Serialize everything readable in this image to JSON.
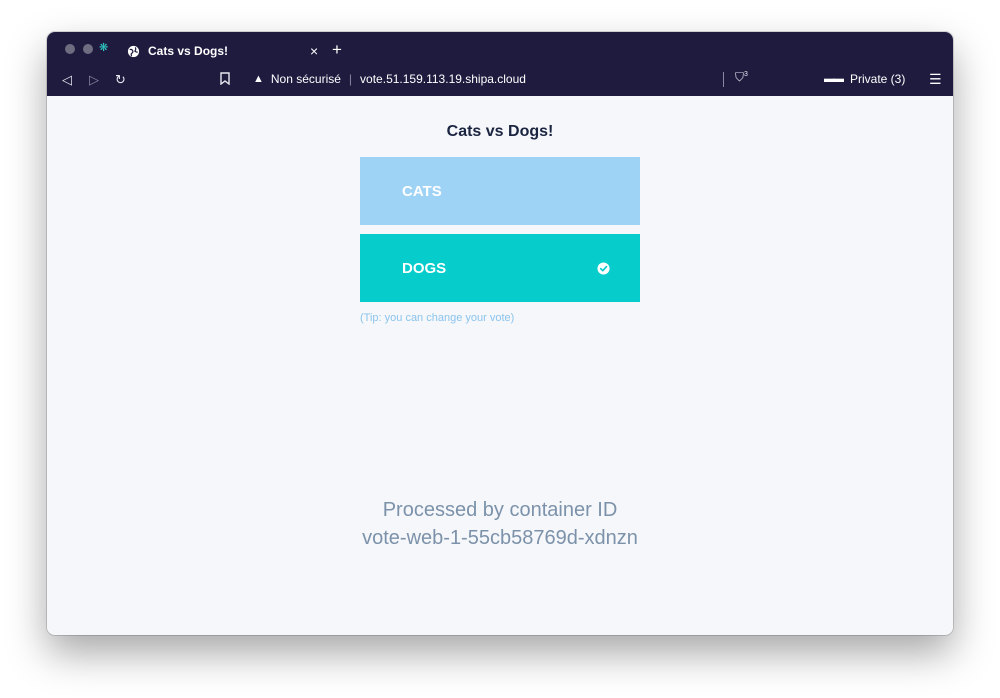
{
  "browser": {
    "tab_title": "Cats vs Dogs!",
    "tab_close": "×",
    "new_tab": "+",
    "security_label": "Non sécurisé",
    "url": "vote.51.159.113.19.shipa.cloud",
    "shield_count": "3",
    "private_label": "Private (3)",
    "icons": {
      "back": "back-icon",
      "forward": "forward-icon",
      "reload": "reload-icon",
      "bookmark": "bookmark-icon",
      "warning": "warning-icon",
      "shield": "shield-icon",
      "private": "private-glasses-icon",
      "menu": "menu-icon"
    }
  },
  "page": {
    "title": "Cats vs Dogs!",
    "options": [
      {
        "label": "CATS",
        "selected": false,
        "color": "#9fd3f6"
      },
      {
        "label": "DOGS",
        "selected": true,
        "color": "#06cccc"
      }
    ],
    "tip": "(Tip: you can change your vote)",
    "processed_line1": "Processed by container ID",
    "processed_line2": "vote-web-1-55cb58769d-xdnzn"
  },
  "colors": {
    "chrome_bg": "#1e1b3f",
    "page_bg": "#f5f7fa",
    "title_text": "#1b2440",
    "processed_text": "#7c92aa"
  }
}
